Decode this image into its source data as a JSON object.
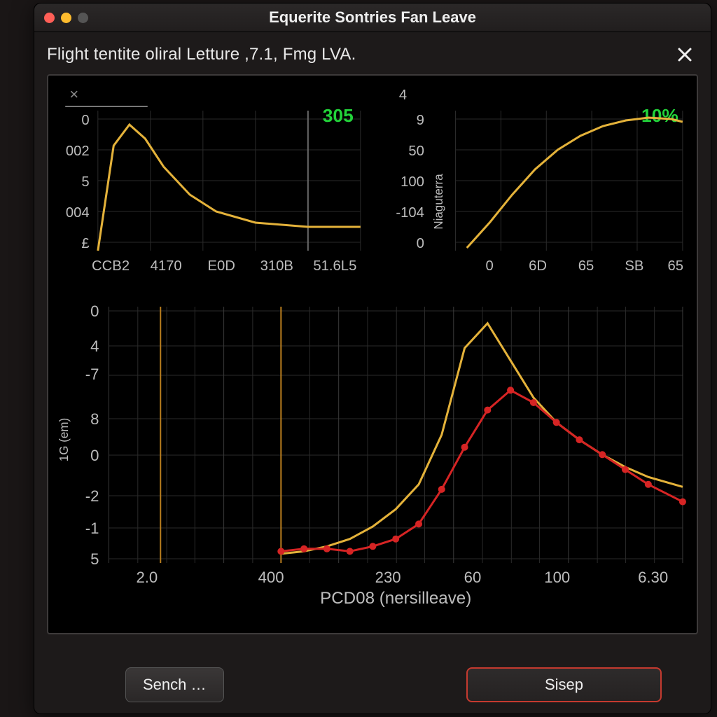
{
  "window": {
    "title": "Equerite Sontries Fan Leave"
  },
  "subheader": {
    "text": "Flight tentite oliral Letture ,7.1, Fmg LVA."
  },
  "buttons": {
    "sench": "Sench …",
    "sisep": "Sisep"
  },
  "chart_data": [
    {
      "id": "top_left",
      "type": "line",
      "badge": "305",
      "corner_mark": "×",
      "y_ticks": [
        "0",
        "002",
        "5",
        "004",
        "£"
      ],
      "x_ticks": [
        "CCB2",
        "4170",
        "E0D",
        "310B",
        "51.6L5"
      ],
      "series": [
        {
          "name": "curve",
          "x": [
            0,
            0.06,
            0.12,
            0.18,
            0.25,
            0.35,
            0.45,
            0.6,
            0.8,
            1.0
          ],
          "y": [
            0.0,
            0.75,
            0.9,
            0.8,
            0.6,
            0.4,
            0.28,
            0.2,
            0.17,
            0.17
          ]
        }
      ],
      "xlim": [
        0,
        1
      ],
      "ylim": [
        0,
        1
      ]
    },
    {
      "id": "top_right",
      "type": "line",
      "badge": "10%",
      "top_label": "4",
      "y_ticks": [
        "9",
        "50",
        "100",
        "-104",
        "0"
      ],
      "y_axis_label": "Niaguterra",
      "x_ticks": [
        "0",
        "6D",
        "65",
        "SB",
        "65"
      ],
      "series": [
        {
          "name": "curve",
          "x": [
            0.05,
            0.15,
            0.25,
            0.35,
            0.45,
            0.55,
            0.65,
            0.75,
            0.85,
            0.95,
            1.0
          ],
          "y": [
            0.02,
            0.2,
            0.4,
            0.58,
            0.72,
            0.82,
            0.89,
            0.93,
            0.95,
            0.94,
            0.92
          ]
        }
      ],
      "xlim": [
        0,
        1
      ],
      "ylim": [
        0,
        1
      ]
    },
    {
      "id": "bottom",
      "type": "line",
      "xlabel": "PCD08 (nersilleave)",
      "ylabel": "1G (em)",
      "y_ticks": [
        "0",
        "4",
        "-7",
        "8",
        "0",
        "-2",
        "-1",
        "5"
      ],
      "x_ticks": [
        "2.0",
        "400",
        "230",
        "60",
        "100",
        "6.30"
      ],
      "vlines_x": [
        0.09,
        0.3
      ],
      "series": [
        {
          "name": "yellow",
          "color": "#e4b23a",
          "x": [
            0.3,
            0.34,
            0.38,
            0.42,
            0.46,
            0.5,
            0.54,
            0.58,
            0.62,
            0.66,
            0.7,
            0.74,
            0.78,
            0.82,
            0.86,
            0.9,
            0.94,
            1.0
          ],
          "y": [
            0.02,
            0.03,
            0.05,
            0.08,
            0.13,
            0.2,
            0.3,
            0.5,
            0.85,
            0.95,
            0.8,
            0.65,
            0.55,
            0.48,
            0.42,
            0.37,
            0.33,
            0.29
          ]
        },
        {
          "name": "red",
          "color": "#d62424",
          "markers": true,
          "x": [
            0.3,
            0.34,
            0.38,
            0.42,
            0.46,
            0.5,
            0.54,
            0.58,
            0.62,
            0.66,
            0.7,
            0.74,
            0.78,
            0.82,
            0.86,
            0.9,
            0.94,
            1.0
          ],
          "y": [
            0.03,
            0.04,
            0.04,
            0.03,
            0.05,
            0.08,
            0.14,
            0.28,
            0.45,
            0.6,
            0.68,
            0.63,
            0.55,
            0.48,
            0.42,
            0.36,
            0.3,
            0.23
          ]
        }
      ],
      "xlim": [
        0,
        1
      ],
      "ylim": [
        0,
        1
      ]
    }
  ]
}
